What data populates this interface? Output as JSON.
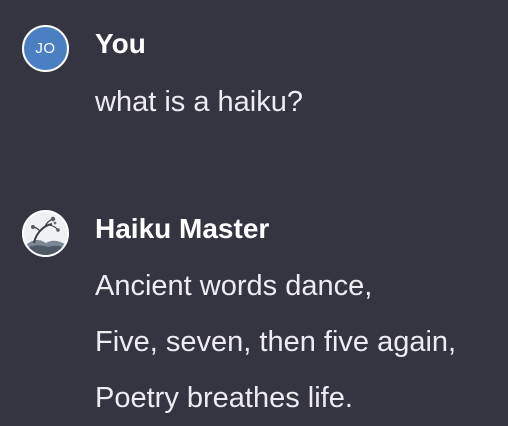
{
  "conversation": {
    "user_message": {
      "avatar_initials": "JO",
      "avatar_color": "#4a7fc1",
      "author": "You",
      "text": "what is a haiku?"
    },
    "bot_message": {
      "avatar_icon": "haiku-master-avatar-icon",
      "author": "Haiku Master",
      "lines": [
        "Ancient words dance,",
        "Five, seven, then five again,",
        "Poetry breathes life."
      ]
    }
  },
  "colors": {
    "background": "#343541",
    "text": "#ececf1",
    "author_text": "#ffffff"
  }
}
